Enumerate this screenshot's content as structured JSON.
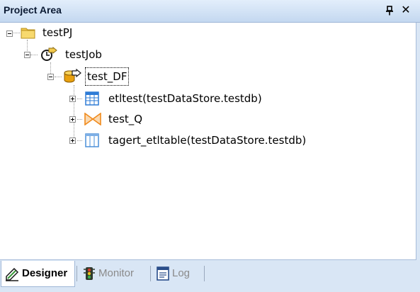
{
  "panel": {
    "title": "Project Area",
    "pin_icon": "pin-icon",
    "close_glyph": "✕"
  },
  "tree": {
    "project": {
      "label": "testPJ",
      "icon": "folder-icon",
      "expanded": true
    },
    "job": {
      "label": "testJob",
      "icon": "job-icon",
      "expanded": true
    },
    "dataflow": {
      "label": "test_DF",
      "icon": "dataflow-icon",
      "expanded": true,
      "selected": true
    },
    "children": [
      {
        "label": "etltest(testDataStore.testdb)",
        "icon": "source-table-icon",
        "expanded": false
      },
      {
        "label": "test_Q",
        "icon": "query-icon",
        "expanded": false
      },
      {
        "label": "tagert_etltable(testDataStore.testdb)",
        "icon": "target-table-icon",
        "expanded": false
      }
    ]
  },
  "tabs": [
    {
      "label": "Designer",
      "icon": "designer-icon",
      "active": true
    },
    {
      "label": "Monitor",
      "icon": "traffic-light-icon",
      "active": false
    },
    {
      "label": "Log",
      "icon": "log-icon",
      "active": false
    }
  ],
  "colors": {
    "title_bg": "#c4d8f0",
    "panel_bg": "#d9e6f5",
    "tree_bg": "#ffffff",
    "folder": "#f2c94c",
    "table_header": "#2e7bd6",
    "query_orange": "#f08a1c"
  }
}
